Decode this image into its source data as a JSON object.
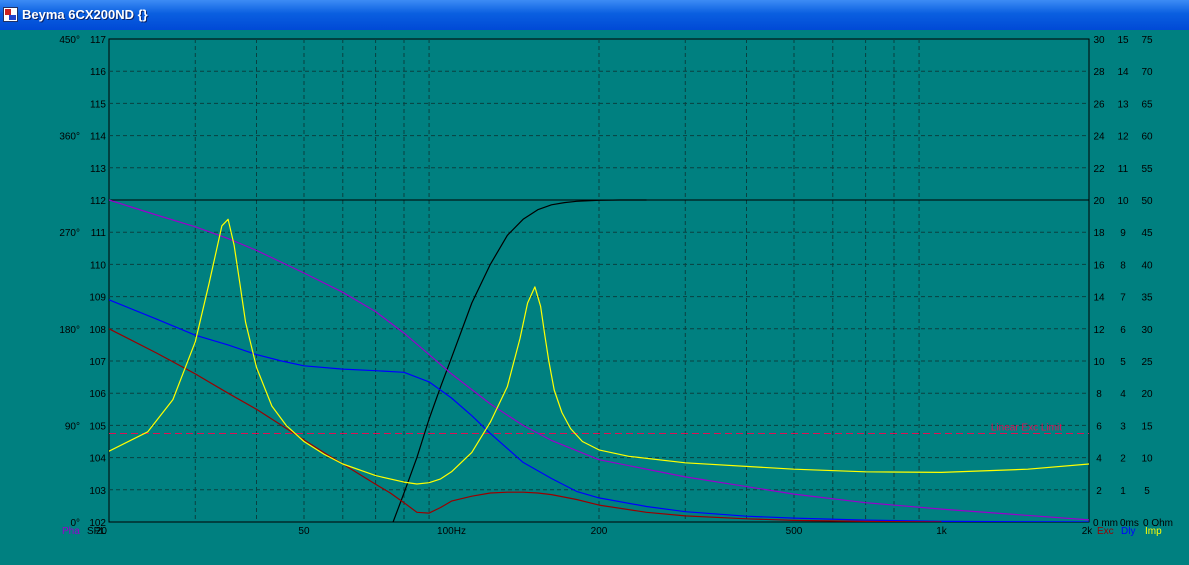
{
  "window": {
    "title": "Beyma 6CX200ND {}"
  },
  "colors": {
    "background": "#008080",
    "grid": "#0a4040",
    "spl": "#000000",
    "phase": "#9900cc",
    "impedance": "#ffff00",
    "delay": "#0000ff",
    "excursion": "#990000",
    "limit": "#dd1155"
  },
  "chart_data": {
    "type": "line",
    "x_scale": "log",
    "xlim": [
      20,
      2000
    ],
    "x_ticks": [
      {
        "value": 20,
        "label": "20"
      },
      {
        "value": 50,
        "label": "50"
      },
      {
        "value": 100,
        "label": "100Hz"
      },
      {
        "value": 200,
        "label": "200"
      },
      {
        "value": 500,
        "label": "500"
      },
      {
        "value": 1000,
        "label": "1k"
      },
      {
        "value": 2000,
        "label": "2k"
      }
    ],
    "axes": {
      "phase": {
        "label": "Pha",
        "ticks": [
          "0°",
          "90°",
          "180°",
          "270°",
          "360°",
          "450°"
        ],
        "ylim": [
          0,
          450
        ]
      },
      "spl": {
        "label": "SPL",
        "ticks": [
          "102",
          "103",
          "104",
          "105",
          "106",
          "107",
          "108",
          "109",
          "110",
          "111",
          "112",
          "113",
          "114",
          "115",
          "116",
          "117"
        ],
        "ylim": [
          102,
          117
        ]
      },
      "excursion": {
        "label": "Exc",
        "unit": "mm",
        "ticks": [
          "0 mm",
          "2",
          "4",
          "6",
          "8",
          "10",
          "12",
          "14",
          "16",
          "18",
          "20",
          "22",
          "24",
          "26",
          "28",
          "30"
        ],
        "ylim": [
          0,
          30
        ]
      },
      "delay": {
        "label": "Dly",
        "unit": "ms",
        "ticks": [
          "0ms",
          "1",
          "2",
          "3",
          "4",
          "5",
          "6",
          "7",
          "8",
          "9",
          "10",
          "11",
          "12",
          "13",
          "14",
          "15"
        ],
        "ylim": [
          0,
          15
        ]
      },
      "impedance": {
        "label": "Imp",
        "unit": "Ohm",
        "ticks": [
          "0 Ohm",
          "5",
          "10",
          "15",
          "20",
          "25",
          "30",
          "35",
          "40",
          "45",
          "50",
          "55",
          "60",
          "65",
          "70",
          "75"
        ],
        "ylim": [
          0,
          75
        ]
      }
    },
    "grid": true,
    "annotations": [
      {
        "text": "Linear Exc Limit",
        "axis": "excursion",
        "y": 5.5
      }
    ],
    "series": [
      {
        "name": "SPL",
        "axis": "spl",
        "color": "#000000",
        "x": [
          76,
          80,
          85,
          90,
          95,
          100,
          110,
          120,
          130,
          140,
          150,
          160,
          170,
          180,
          200,
          220,
          250
        ],
        "y": [
          102,
          102.9,
          104.0,
          105.2,
          106.2,
          107.1,
          108.8,
          110.0,
          110.9,
          111.4,
          111.7,
          111.85,
          111.92,
          111.96,
          111.99,
          112,
          112
        ]
      },
      {
        "name": "Phase",
        "axis": "phase",
        "color": "#9900cc",
        "x": [
          20,
          25,
          30,
          35,
          40,
          50,
          60,
          70,
          80,
          90,
          100,
          120,
          140,
          160,
          200,
          300,
          500,
          700,
          1000,
          2000
        ],
        "y": [
          300,
          286,
          275,
          264,
          253,
          232,
          214,
          196,
          176,
          156,
          138,
          110,
          90,
          76,
          58,
          42,
          26,
          18,
          12,
          2
        ]
      },
      {
        "name": "Dly",
        "axis": "delay",
        "color": "#0000ff",
        "x": [
          20,
          25,
          30,
          35,
          40,
          45,
          50,
          60,
          70,
          80,
          90,
          100,
          110,
          120,
          140,
          160,
          180,
          200,
          250,
          300,
          400,
          500,
          700,
          1000,
          2000
        ],
        "y": [
          6.9,
          6.3,
          5.8,
          5.5,
          5.2,
          5.0,
          4.85,
          4.75,
          4.7,
          4.65,
          4.35,
          3.85,
          3.3,
          2.75,
          1.85,
          1.35,
          0.95,
          0.75,
          0.48,
          0.32,
          0.18,
          0.12,
          0.06,
          0.02,
          0.0
        ]
      },
      {
        "name": "Exc",
        "axis": "excursion",
        "color": "#990000",
        "x": [
          20,
          25,
          30,
          35,
          40,
          45,
          50,
          55,
          60,
          65,
          70,
          75,
          80,
          85,
          90,
          95,
          100,
          110,
          120,
          130,
          140,
          150,
          160,
          180,
          200,
          250,
          300,
          400,
          500,
          700,
          1000
        ],
        "y": [
          12,
          10.5,
          9.2,
          8.0,
          7.0,
          6.0,
          5.1,
          4.3,
          3.6,
          2.95,
          2.35,
          1.8,
          1.2,
          0.6,
          0.55,
          0.9,
          1.3,
          1.6,
          1.8,
          1.85,
          1.85,
          1.8,
          1.7,
          1.4,
          1.05,
          0.6,
          0.38,
          0.2,
          0.1,
          0.04,
          0.0
        ]
      },
      {
        "name": "Imp",
        "axis": "impedance",
        "color": "#ffff00",
        "x": [
          20,
          24,
          27,
          30,
          32,
          34,
          35,
          36,
          37,
          38,
          40,
          43,
          46,
          50,
          55,
          60,
          70,
          80,
          85,
          90,
          95,
          100,
          110,
          120,
          130,
          138,
          143,
          148,
          152,
          155,
          158,
          162,
          168,
          175,
          185,
          200,
          230,
          300,
          500,
          700,
          1000,
          1500,
          2000
        ],
        "y": [
          11,
          14,
          19,
          28,
          37,
          46,
          47,
          43,
          37,
          31,
          24,
          18,
          15,
          12.5,
          10.5,
          9,
          7.2,
          6.2,
          5.9,
          6.1,
          6.7,
          7.8,
          10.8,
          15.5,
          21,
          28.5,
          34,
          36.5,
          33.5,
          29,
          25,
          20.5,
          17,
          14.5,
          12.5,
          11.2,
          10.2,
          9.2,
          8.2,
          7.8,
          7.7,
          8.2,
          9
        ]
      }
    ]
  }
}
